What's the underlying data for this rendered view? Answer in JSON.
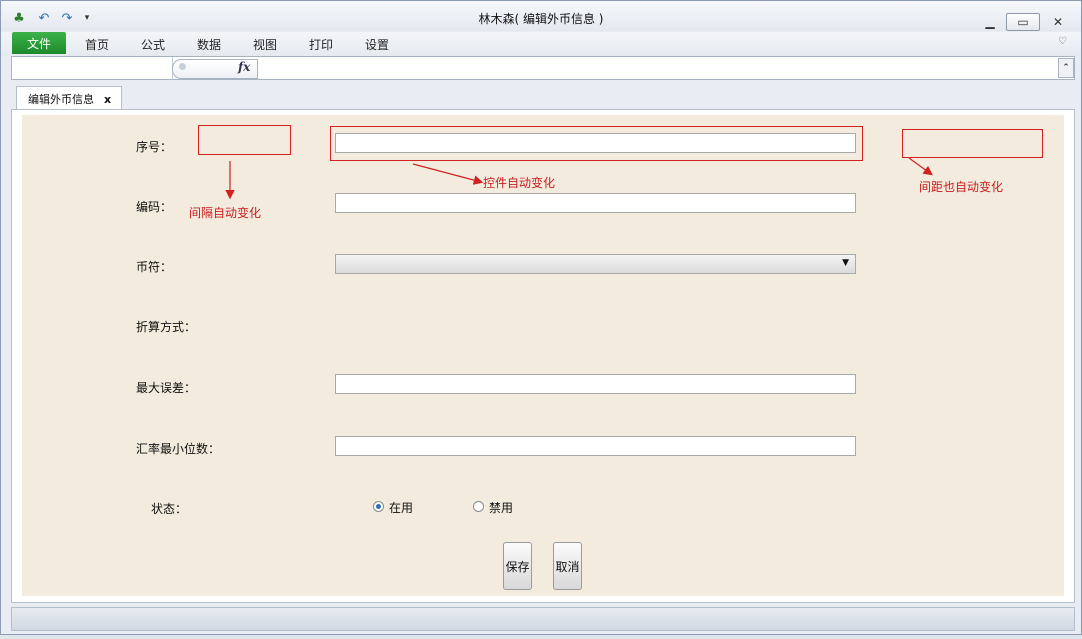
{
  "window": {
    "title": "林木森( 编辑外币信息 )"
  },
  "ribbon": {
    "tabs": [
      "文件",
      "首页",
      "公式",
      "数据",
      "视图",
      "打印",
      "设置"
    ]
  },
  "formula_bar": {
    "fx_label": "fx"
  },
  "doc_tab": {
    "label": "编辑外币信息",
    "close": "x"
  },
  "form": {
    "serial_label": "序号：",
    "code_label": "编码：",
    "currency_label": "币符：",
    "conversion_label": "折算方式：",
    "max_error_label": "最大误差：",
    "min_digits_label": "汇率最小位数：",
    "status_label": "状态：",
    "status_options": [
      {
        "label": "在用",
        "selected": true
      },
      {
        "label": "禁用",
        "selected": false
      }
    ],
    "save_label": "保存",
    "cancel_label": "取消"
  },
  "annotations": {
    "spacing_auto": "间隔自动变化",
    "control_auto": "控件自动变化",
    "margin_auto": "间距也自动变化",
    "annotation_color": "#d32020"
  },
  "colors": {
    "form_bg": "#f2ebde",
    "file_tab": "#1c8a2b"
  }
}
